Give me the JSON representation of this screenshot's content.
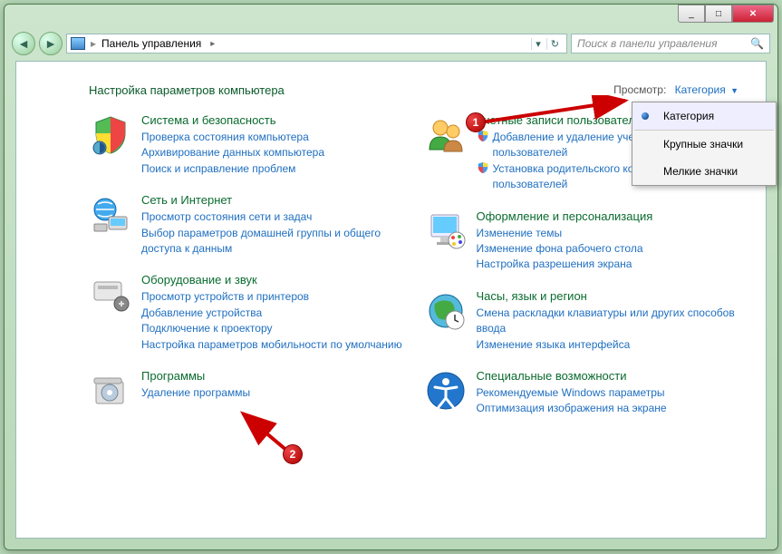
{
  "titlebar": {
    "min": "_",
    "max": "□",
    "close": "✕"
  },
  "address": {
    "label": "Панель управления",
    "search_placeholder": "Поиск в панели управления"
  },
  "heading": "Настройка параметров компьютера",
  "view": {
    "label": "Просмотр:",
    "value": "Категория"
  },
  "dropdown": {
    "items": [
      {
        "label": "Категория",
        "selected": true
      },
      {
        "label": "Крупные значки",
        "selected": false
      },
      {
        "label": "Мелкие значки",
        "selected": false
      }
    ]
  },
  "left_categories": [
    {
      "title": "Система и безопасность",
      "links": [
        "Проверка состояния компьютера",
        "Архивирование данных компьютера",
        "Поиск и исправление проблем"
      ]
    },
    {
      "title": "Сеть и Интернет",
      "links": [
        "Просмотр состояния сети и задач",
        "Выбор параметров домашней группы и общего доступа к данным"
      ]
    },
    {
      "title": "Оборудование и звук",
      "links": [
        "Просмотр устройств и принтеров",
        "Добавление устройства",
        "Подключение к проектору",
        "Настройка параметров мобильности по умолчанию"
      ]
    },
    {
      "title": "Программы",
      "links": [
        "Удаление программы"
      ]
    }
  ],
  "right_categories": [
    {
      "title": "Учетные записи пользователей и семейн...",
      "shield_links": [
        "Добавление и удаление учетных записей пользователей",
        "Установка родительского контроля для всех пользователей"
      ]
    },
    {
      "title": "Оформление и персонализация",
      "links": [
        "Изменение темы",
        "Изменение фона рабочего стола",
        "Настройка разрешения экрана"
      ]
    },
    {
      "title": "Часы, язык и регион",
      "links": [
        "Смена раскладки клавиатуры или других способов ввода",
        "Изменение языка интерфейса"
      ]
    },
    {
      "title": "Специальные возможности",
      "links": [
        "Рекомендуемые Windows параметры",
        "Оптимизация изображения на экране"
      ]
    }
  ],
  "annotations": {
    "bubble1": "1",
    "bubble2": "2"
  }
}
